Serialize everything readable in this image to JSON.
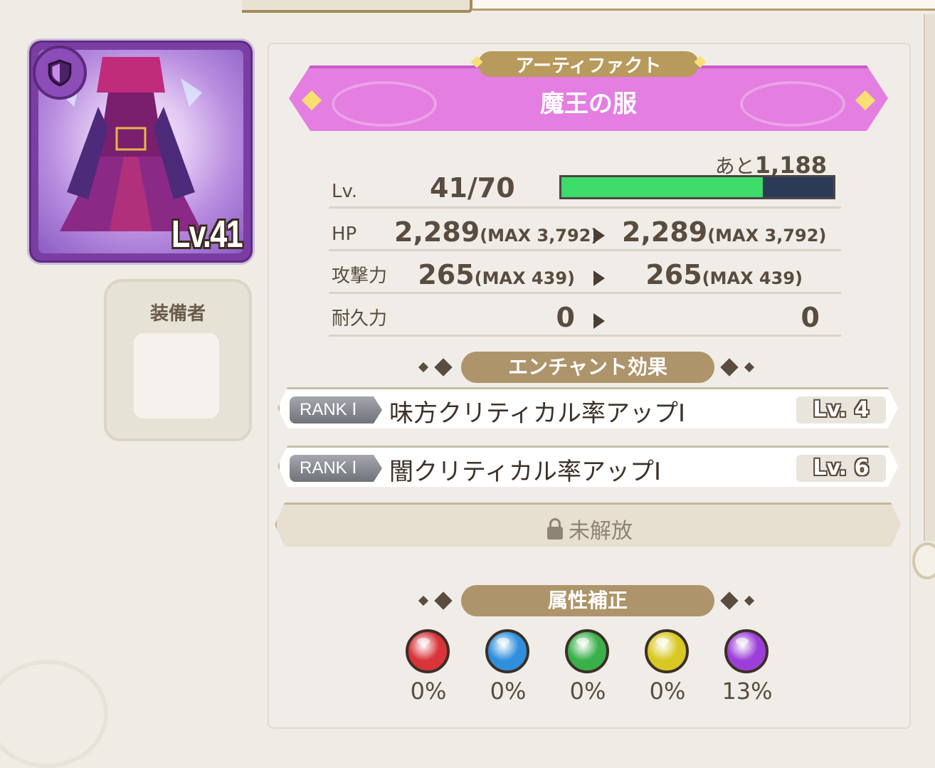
{
  "artifact": {
    "level_badge": "Lv.41",
    "type_icon": "shield-icon",
    "category": "アーティファクト",
    "name": "魔王の服",
    "banner_color": "#e47ee0"
  },
  "equipper": {
    "label": "装備者"
  },
  "level": {
    "label": "Lv.",
    "value": "41/70",
    "remaining_prefix": "あと",
    "remaining_value": "1,188",
    "progress": 0.74
  },
  "stats": [
    {
      "label": "HP",
      "current": "2,289",
      "current_max": "(MAX 3,792)",
      "next": "2,289",
      "next_max": "(MAX 3,792)"
    },
    {
      "label": "攻撃力",
      "current": "265",
      "current_max": "(MAX 439)",
      "next": "265",
      "next_max": "(MAX 439)"
    },
    {
      "label": "耐久力",
      "current": "0",
      "current_max": "",
      "next": "0",
      "next_max": ""
    }
  ],
  "enchant": {
    "title": "エンチャント効果",
    "items": [
      {
        "rank": "RANK Ⅰ",
        "name": "味方クリティカル率アップⅠ",
        "level": "Lv. 4"
      },
      {
        "rank": "RANK Ⅰ",
        "name": "闇クリティカル率アップⅠ",
        "level": "Lv. 6"
      }
    ],
    "locked_label": "未解放"
  },
  "attribute": {
    "title": "属性補正",
    "elements": [
      {
        "name": "fire",
        "icon": "fire-icon",
        "color": "#d8343a",
        "value": "0%"
      },
      {
        "name": "water",
        "icon": "water-icon",
        "color": "#2f8fdc",
        "value": "0%"
      },
      {
        "name": "wind",
        "icon": "wind-icon",
        "color": "#3ab04a",
        "value": "0%"
      },
      {
        "name": "light",
        "icon": "light-icon",
        "color": "#d8c824",
        "value": "0%"
      },
      {
        "name": "dark",
        "icon": "dark-icon",
        "color": "#9c3fd8",
        "value": "13%"
      }
    ]
  }
}
